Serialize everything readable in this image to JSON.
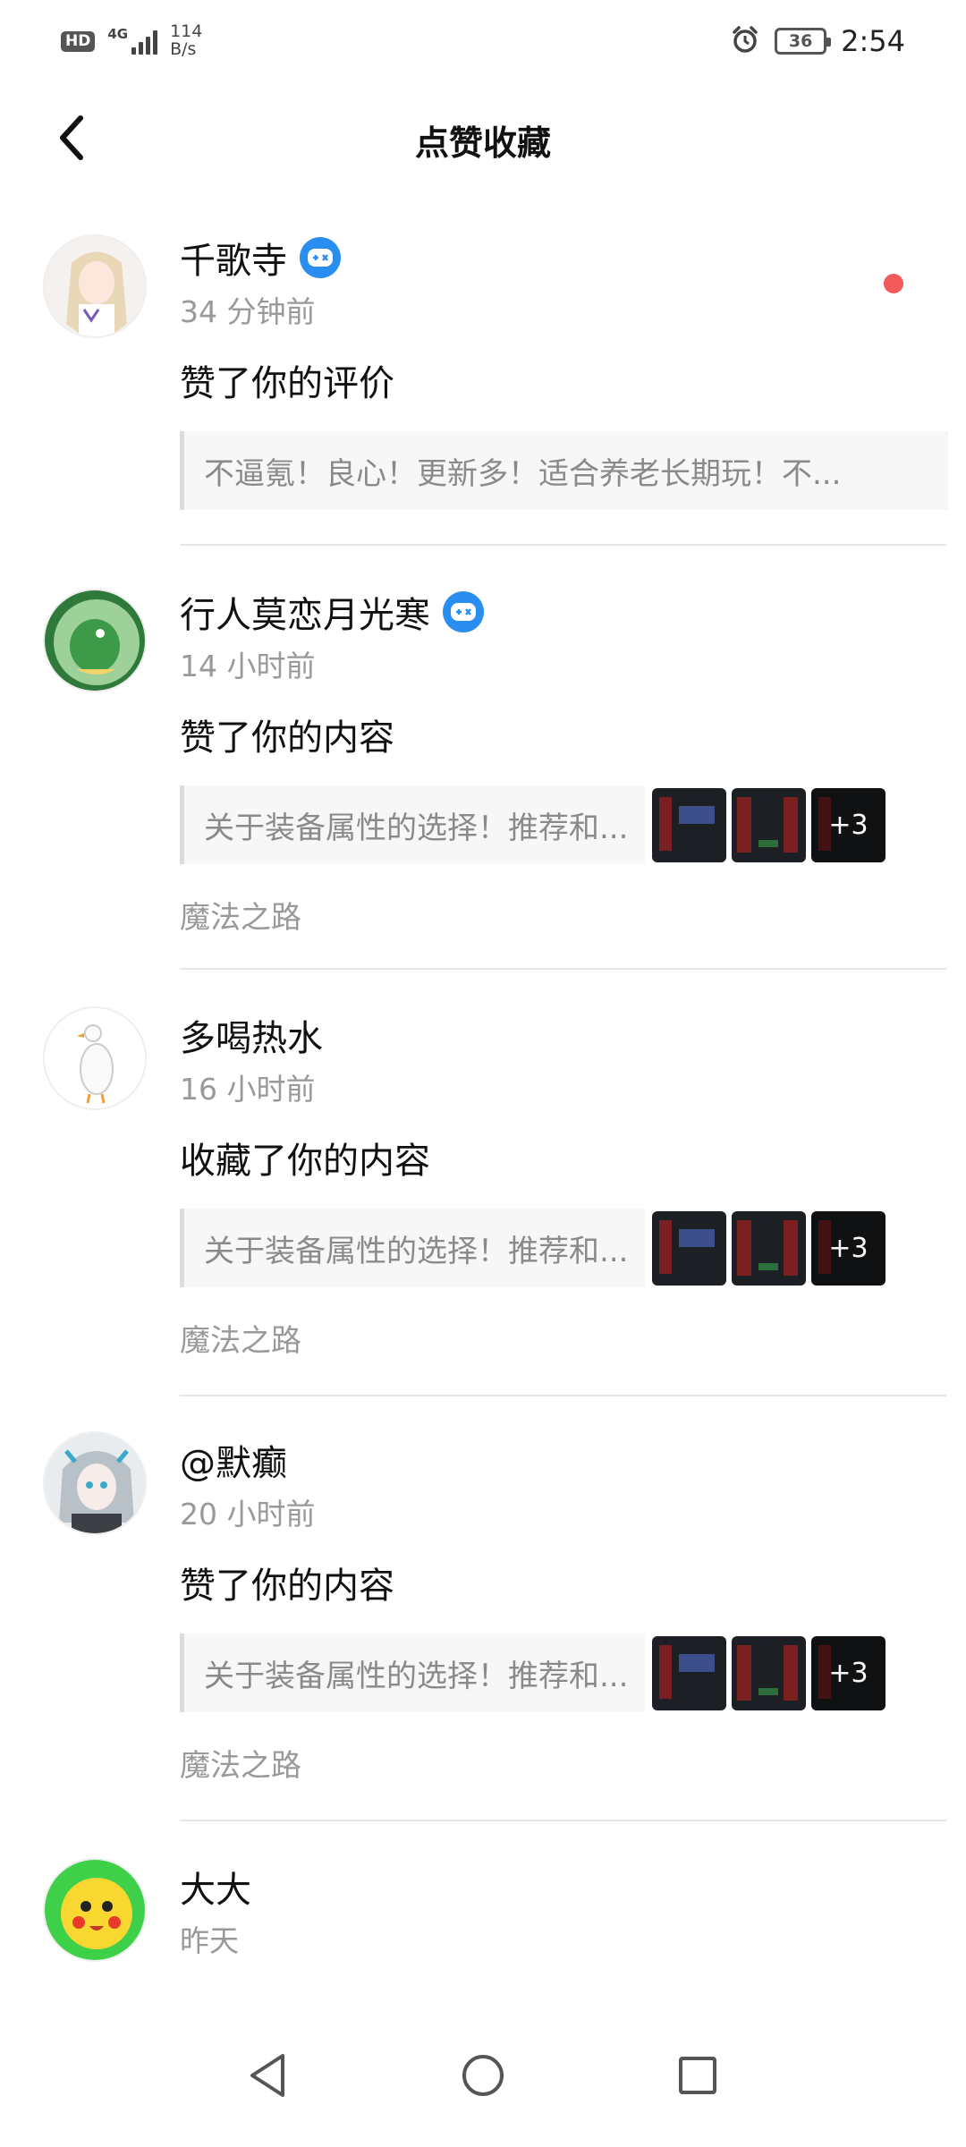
{
  "status_bar": {
    "hd": "HD",
    "network": "4G",
    "speed_value": "114",
    "speed_unit": "B/s",
    "battery": "36",
    "time": "2:54"
  },
  "header": {
    "title": "点赞收藏"
  },
  "feed": [
    {
      "name": "千歌寺",
      "has_game_badge": true,
      "time": "34 分钟前",
      "action": "赞了你的评价",
      "quote": "不逼氪！良心！更新多！适合养老长期玩！不...",
      "unread": true
    },
    {
      "name": "行人莫恋月光寒",
      "has_game_badge": true,
      "time": "14 小时前",
      "action": "赞了你的内容",
      "quote": "关于装备属性的选择！推荐和...",
      "more_count": "+3",
      "game": "魔法之路"
    },
    {
      "name": "多喝热水",
      "time": "16 小时前",
      "action": "收藏了你的内容",
      "quote": "关于装备属性的选择！推荐和...",
      "more_count": "+3",
      "game": "魔法之路"
    },
    {
      "name": "@默癫",
      "time": "20 小时前",
      "action": "赞了你的内容",
      "quote": "关于装备属性的选择！推荐和...",
      "more_count": "+3",
      "game": "魔法之路"
    },
    {
      "name": "大大",
      "time": "昨天"
    }
  ],
  "colors": {
    "accent_blue": "#2a8ef0",
    "unread_red": "#f25a5a",
    "muted_text": "#999999"
  }
}
